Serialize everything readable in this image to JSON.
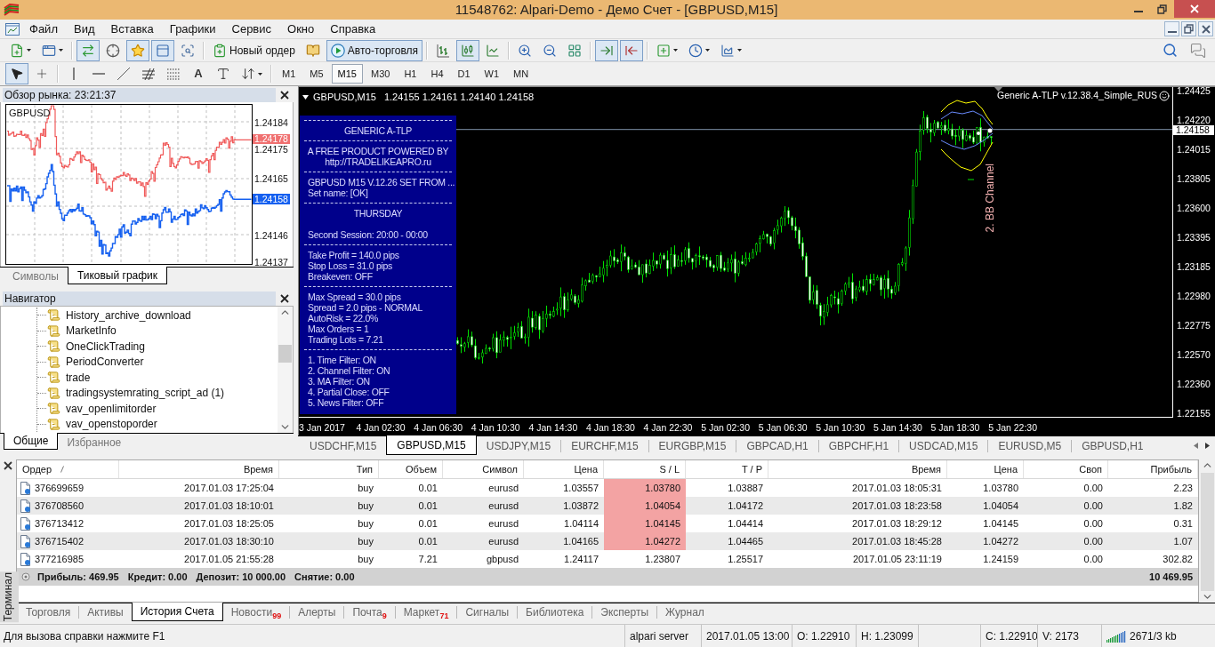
{
  "window": {
    "title": "11548762: Alpari-Demo - Демо Счет - [GBPUSD,M15]"
  },
  "menu": [
    "Файл",
    "Вид",
    "Вставка",
    "Графики",
    "Сервис",
    "Окно",
    "Справка"
  ],
  "toolbar": [
    [
      {
        "kind": "new-chart",
        "on": false
      },
      {
        "kind": "profiles",
        "on": false
      }
    ],
    [
      {
        "kind": "market-watch",
        "on": true
      },
      {
        "kind": "data-window",
        "on": false
      },
      {
        "kind": "navigator",
        "on": true
      },
      {
        "kind": "terminal",
        "on": true
      },
      {
        "kind": "tester",
        "on": false
      }
    ],
    [
      {
        "kind": "new-order",
        "label": "Новый ордер",
        "on": false
      },
      {
        "kind": "editor",
        "on": false
      },
      {
        "kind": "auto-trading",
        "label": "Авто-торговля",
        "on": true
      }
    ],
    [
      {
        "kind": "bar-chart",
        "on": false
      },
      {
        "kind": "candles",
        "on": true
      },
      {
        "kind": "line-chart",
        "on": false
      }
    ],
    [
      {
        "kind": "zoom-in",
        "on": false
      },
      {
        "kind": "zoom-out",
        "on": false
      },
      {
        "kind": "tile",
        "on": false
      }
    ],
    [
      {
        "kind": "chart-shift",
        "on": true
      },
      {
        "kind": "auto-scroll",
        "on": true
      }
    ],
    [
      {
        "kind": "indicators",
        "on": false
      },
      {
        "kind": "periods",
        "on": false
      },
      {
        "kind": "templates",
        "on": false
      }
    ]
  ],
  "drawing_tools": [
    [
      {
        "kind": "cursor",
        "on": true
      },
      {
        "kind": "crosshair",
        "on": false
      }
    ],
    [
      {
        "kind": "vline",
        "on": false
      },
      {
        "kind": "hline",
        "on": false
      },
      {
        "kind": "trendline",
        "on": false
      },
      {
        "kind": "fibo-channel",
        "on": false
      },
      {
        "kind": "fibo",
        "on": false
      },
      {
        "kind": "text",
        "label": "A",
        "on": false
      },
      {
        "kind": "label",
        "on": false
      },
      {
        "kind": "arrows",
        "on": false
      }
    ]
  ],
  "timeframes": [
    {
      "label": "M1",
      "selected": false
    },
    {
      "label": "M5",
      "selected": false
    },
    {
      "label": "M15",
      "selected": true
    },
    {
      "label": "M30",
      "selected": false
    },
    {
      "label": "H1",
      "selected": false
    },
    {
      "label": "H4",
      "selected": false
    },
    {
      "label": "D1",
      "selected": false
    },
    {
      "label": "W1",
      "selected": false
    },
    {
      "label": "MN",
      "selected": false
    }
  ],
  "market_watch": {
    "title": "Обзор рынка: 23:21:37",
    "symbol": "GBPUSD",
    "price_labels": [
      "1.24184",
      "1.24175",
      "1.24165",
      "1.24146",
      "1.24137"
    ],
    "ask": "1.24178",
    "bid": "1.24158",
    "tabs": [
      {
        "label": "Символы",
        "selected": false
      },
      {
        "label": "Тиковый график",
        "selected": true
      }
    ]
  },
  "navigator": {
    "title": "Навигатор",
    "items": [
      "History_archive_download",
      "MarketInfo",
      "OneClickTrading",
      "PeriodConverter",
      "trade",
      "tradingsystemrating_script_ad (1)",
      "vav_openlimitorder",
      "vav_openstoporder"
    ],
    "tabs": [
      {
        "label": "Общие",
        "selected": true
      },
      {
        "label": "Избранное",
        "selected": false
      }
    ]
  },
  "chart": {
    "symbol": "GBPUSD,M15",
    "ohlc": "1.24155 1.24161 1.24140 1.24158",
    "expert": "Generic A-TLP v.12.38.4_Simple_RUS",
    "price_axis": [
      "1.24425",
      "1.24220",
      "1.24015",
      "1.23805",
      "1.23600",
      "1.23395",
      "1.23185",
      "1.22980",
      "1.22775",
      "1.22570",
      "1.22360",
      "1.22155"
    ],
    "current_price": "1.24158",
    "time_axis": [
      "3 Jan 2017",
      "4 Jan 02:30",
      "4 Jan 06:30",
      "4 Jan 10:30",
      "4 Jan 14:30",
      "4 Jan 18:30",
      "4 Jan 22:30",
      "5 Jan 02:30",
      "5 Jan 06:30",
      "5 Jan 10:30",
      "5 Jan 14:30",
      "5 Jan 18:30",
      "5 Jan 22:30"
    ],
    "indicator_label": "2. BB Channel",
    "info_panel": [
      [
        {
          "kind": "title",
          "text": "GENERIC A-TLP"
        }
      ],
      [
        {
          "kind": "title",
          "text": "A FREE PRODUCT POWERED BY"
        },
        {
          "kind": "title",
          "text": "http://TRADELIKEAPRO.ru"
        }
      ],
      [
        {
          "kind": "text",
          "text": "GBPUSD M15 V.12.26 SET FROM ..."
        },
        {
          "kind": "text",
          "text": "Set name: [OK]"
        }
      ],
      [
        {
          "kind": "title",
          "text": "THURSDAY"
        },
        {
          "kind": "text",
          "text": "Second Session: 20:00 - 00:00"
        }
      ],
      [
        {
          "kind": "text",
          "text": "Take Profit = 140.0 pips"
        },
        {
          "kind": "text",
          "text": "Stop Loss = 31.0 pips"
        },
        {
          "kind": "text",
          "text": "Breakeven: OFF"
        }
      ],
      [
        {
          "kind": "text",
          "text": "Max Spread = 30.0 pips"
        },
        {
          "kind": "text",
          "text": "Spread = 2.0 pips - NORMAL"
        },
        {
          "kind": "text",
          "text": "AutoRisk = 22.0%"
        },
        {
          "kind": "text",
          "text": "Max Orders = 1"
        },
        {
          "kind": "text",
          "text": "Trading Lots = 7.21"
        }
      ],
      [
        {
          "kind": "text",
          "text": "1. Time Filter: ON"
        },
        {
          "kind": "text",
          "text": "2. Channel Filter: ON"
        },
        {
          "kind": "text",
          "text": "3. MA Filter: ON"
        },
        {
          "kind": "text",
          "text": "4. Partial Close: OFF"
        },
        {
          "kind": "text",
          "text": "5. News Filter: OFF"
        }
      ]
    ]
  },
  "chart_tabs": [
    {
      "label": "USDCHF,M15",
      "selected": false
    },
    {
      "label": "GBPUSD,M15",
      "selected": true
    },
    {
      "label": "USDJPY,M15",
      "selected": false
    },
    {
      "label": "EURCHF,M15",
      "selected": false
    },
    {
      "label": "EURGBP,M15",
      "selected": false
    },
    {
      "label": "GBPCAD,H1",
      "selected": false
    },
    {
      "label": "GBPCHF,H1",
      "selected": false
    },
    {
      "label": "USDCAD,M15",
      "selected": false
    },
    {
      "label": "EURUSD,M5",
      "selected": false
    },
    {
      "label": "GBPUSD,H1",
      "selected": false
    }
  ],
  "terminal": {
    "title": "Терминал",
    "columns": [
      {
        "label": "Ордер",
        "sorted": true
      },
      {
        "label": "Время",
        "sorted": false
      },
      {
        "label": "Тип",
        "sorted": false
      },
      {
        "label": "Объем",
        "sorted": false
      },
      {
        "label": "Символ",
        "sorted": false
      },
      {
        "label": "Цена",
        "sorted": false
      },
      {
        "label": "S / L",
        "sorted": false
      },
      {
        "label": "T / P",
        "sorted": false
      },
      {
        "label": "Время",
        "sorted": false
      },
      {
        "label": "Цена",
        "sorted": false
      },
      {
        "label": "Своп",
        "sorted": false
      },
      {
        "label": "Прибыль",
        "sorted": false
      }
    ],
    "rows": [
      {
        "cells": [
          "376699659",
          "2017.01.03 17:25:04",
          "buy",
          "0.01",
          "eurusd",
          "1.03557",
          "1.03780",
          "1.03887",
          "2017.01.03 18:05:31",
          "1.03780",
          "0.00",
          "2.23"
        ],
        "sl_hit": true
      },
      {
        "cells": [
          "376708560",
          "2017.01.03 18:10:01",
          "buy",
          "0.01",
          "eurusd",
          "1.03872",
          "1.04054",
          "1.04172",
          "2017.01.03 18:23:58",
          "1.04054",
          "0.00",
          "1.82"
        ],
        "sl_hit": true
      },
      {
        "cells": [
          "376713412",
          "2017.01.03 18:25:05",
          "buy",
          "0.01",
          "eurusd",
          "1.04114",
          "1.04145",
          "1.04414",
          "2017.01.03 18:29:12",
          "1.04145",
          "0.00",
          "0.31"
        ],
        "sl_hit": true
      },
      {
        "cells": [
          "376715402",
          "2017.01.03 18:30:10",
          "buy",
          "0.01",
          "eurusd",
          "1.04165",
          "1.04272",
          "1.04465",
          "2017.01.03 18:45:28",
          "1.04272",
          "0.00",
          "1.07"
        ],
        "sl_hit": true
      },
      {
        "cells": [
          "377216985",
          "2017.01.05 21:55:28",
          "buy",
          "7.21",
          "gbpusd",
          "1.24117",
          "1.23807",
          "1.25517",
          "2017.01.05 23:11:19",
          "1.24159",
          "0.00",
          "302.82"
        ],
        "sl_hit": false
      }
    ],
    "summary": [
      "Прибыль: 469.95",
      "Кредит: 0.00",
      "Депозит: 10 000.00",
      "Снятие: 0.00"
    ],
    "total": "10 469.95",
    "tabs": [
      {
        "label": "Торговля",
        "selected": false
      },
      {
        "label": "Активы",
        "selected": false
      },
      {
        "label": "История Счета",
        "selected": true
      },
      {
        "label": "Новости",
        "badge": "99",
        "selected": false
      },
      {
        "label": "Алерты",
        "selected": false
      },
      {
        "label": "Почта",
        "badge": "9",
        "selected": false
      },
      {
        "label": "Маркет",
        "badge": "71",
        "selected": false
      },
      {
        "label": "Сигналы",
        "selected": false
      },
      {
        "label": "Библиотека",
        "selected": false
      },
      {
        "label": "Эксперты",
        "selected": false
      },
      {
        "label": "Журнал",
        "selected": false
      }
    ]
  },
  "status_bar": {
    "help": "Для вызова справки нажмите F1",
    "server": "alpari server",
    "datetime": "2017.01.05 13:00",
    "open": "O: 1.22910",
    "high": "H: 1.23099",
    "close": "C: 1.22910",
    "volume": "V: 2173",
    "traffic": "2671/3 kb"
  }
}
